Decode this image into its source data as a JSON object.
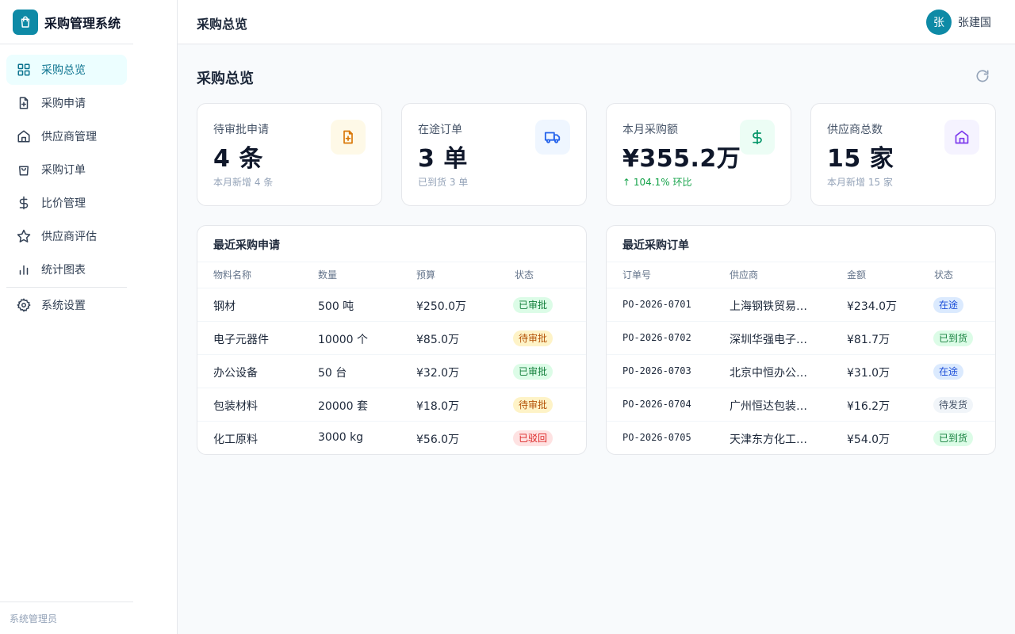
{
  "app": {
    "title": "采购管理系统"
  },
  "sidebar": {
    "items": [
      {
        "label": "采购总览",
        "icon": "grid-icon",
        "active": true
      },
      {
        "label": "采购申请",
        "icon": "file-plus-icon"
      },
      {
        "label": "供应商管理",
        "icon": "home-icon"
      },
      {
        "label": "采购订单",
        "icon": "shopping-bag-icon"
      },
      {
        "label": "比价管理",
        "icon": "dollar-icon"
      },
      {
        "label": "供应商评估",
        "icon": "star-icon"
      },
      {
        "label": "统计图表",
        "icon": "bar-chart-icon"
      }
    ],
    "settings_label": "系统设置",
    "footer": "系统管理员"
  },
  "header": {
    "title": "采购总览",
    "user_initial": "张",
    "user_name": "张建国"
  },
  "main": {
    "title": "采购总览",
    "stats": [
      {
        "label": "待审批申请",
        "value": "4 条",
        "sub": "本月新增 4 条",
        "icon": "file-plus-icon",
        "color": "#d97706"
      },
      {
        "label": "在途订单",
        "value": "3 单",
        "sub": "已到货 3 单",
        "icon": "truck-icon",
        "color": "#2563eb"
      },
      {
        "label": "本月采购额",
        "value": "¥355.2万",
        "sub": "↑ 104.1% 环比",
        "icon": "dollar-icon",
        "color": "#059669"
      },
      {
        "label": "供应商总数",
        "value": "15 家",
        "sub": "本月新增 15 家",
        "icon": "home-icon",
        "color": "#7c3aed"
      }
    ],
    "requests": {
      "title": "最近采购申请",
      "columns": [
        "物料名称",
        "数量",
        "预算",
        "状态"
      ],
      "rows": [
        {
          "name": "钢材",
          "qty": "500 吨",
          "budget": "¥250.0万",
          "status": "已审批",
          "tone": "green"
        },
        {
          "name": "电子元器件",
          "qty": "10000 个",
          "budget": "¥85.0万",
          "status": "待审批",
          "tone": "yellow"
        },
        {
          "name": "办公设备",
          "qty": "50 台",
          "budget": "¥32.0万",
          "status": "已审批",
          "tone": "green"
        },
        {
          "name": "包装材料",
          "qty": "20000 套",
          "budget": "¥18.0万",
          "status": "待审批",
          "tone": "yellow"
        },
        {
          "name": "化工原料",
          "qty": "3000 kg",
          "budget": "¥56.0万",
          "status": "已驳回",
          "tone": "red"
        }
      ]
    },
    "orders": {
      "title": "最近采购订单",
      "columns": [
        "订单号",
        "供应商",
        "金额",
        "状态"
      ],
      "rows": [
        {
          "no": "PO-2026-0701",
          "supplier": "上海钢铁贸易…",
          "amount": "¥234.0万",
          "status": "在途",
          "tone": "blue"
        },
        {
          "no": "PO-2026-0702",
          "supplier": "深圳华强电子…",
          "amount": "¥81.7万",
          "status": "已到货",
          "tone": "green"
        },
        {
          "no": "PO-2026-0703",
          "supplier": "北京中恒办公…",
          "amount": "¥31.0万",
          "status": "在途",
          "tone": "blue"
        },
        {
          "no": "PO-2026-0704",
          "supplier": "广州恒达包装…",
          "amount": "¥16.2万",
          "status": "待发货",
          "tone": "gray"
        },
        {
          "no": "PO-2026-0705",
          "supplier": "天津东方化工…",
          "amount": "¥54.0万",
          "status": "已到货",
          "tone": "green"
        }
      ]
    }
  }
}
